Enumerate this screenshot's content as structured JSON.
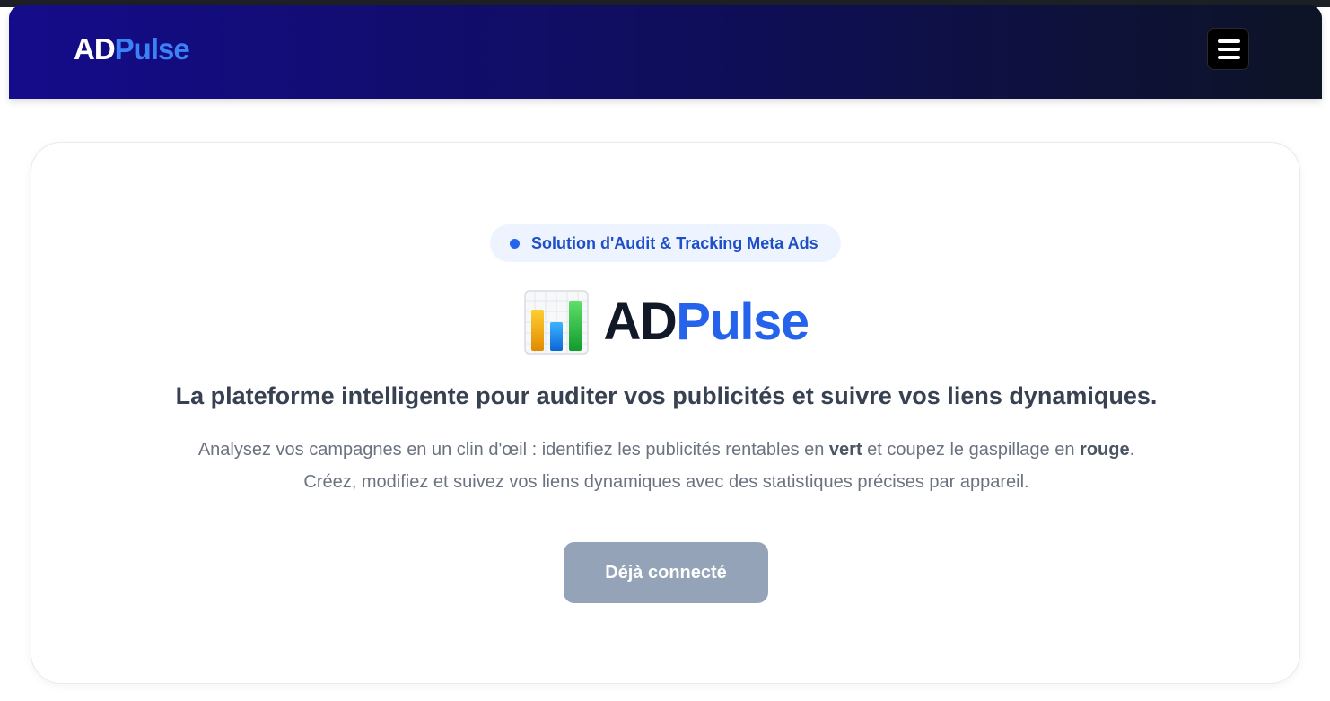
{
  "navbar": {
    "logo_ad": "AD",
    "logo_pulse": "Pulse",
    "menu_icon": "hamburger-menu-icon"
  },
  "hero": {
    "badge": "Solution d'Audit & Tracking Meta Ads",
    "icon": "bar-chart-icon",
    "logo_ad": "AD",
    "logo_pulse": "Pulse",
    "subtitle": "La plateforme intelligente pour auditer vos publicités et suivre vos liens dynamiques.",
    "desc_1": "Analysez vos campagnes en un clin d'œil : identifiez les publicités rentables en ",
    "desc_bold_1": "vert",
    "desc_2": " et coupez le gaspillage en ",
    "desc_bold_2": "rouge",
    "desc_3": ". Créez, modifiez et suivez vos liens dynamiques avec des statistiques précises par appareil.",
    "cta_label": "Déjà connecté"
  },
  "colors": {
    "accent": "#2563eb",
    "navbar_start": "#140c8a",
    "navbar_end": "#0d1426",
    "cta_disabled": "#94a3b8"
  }
}
